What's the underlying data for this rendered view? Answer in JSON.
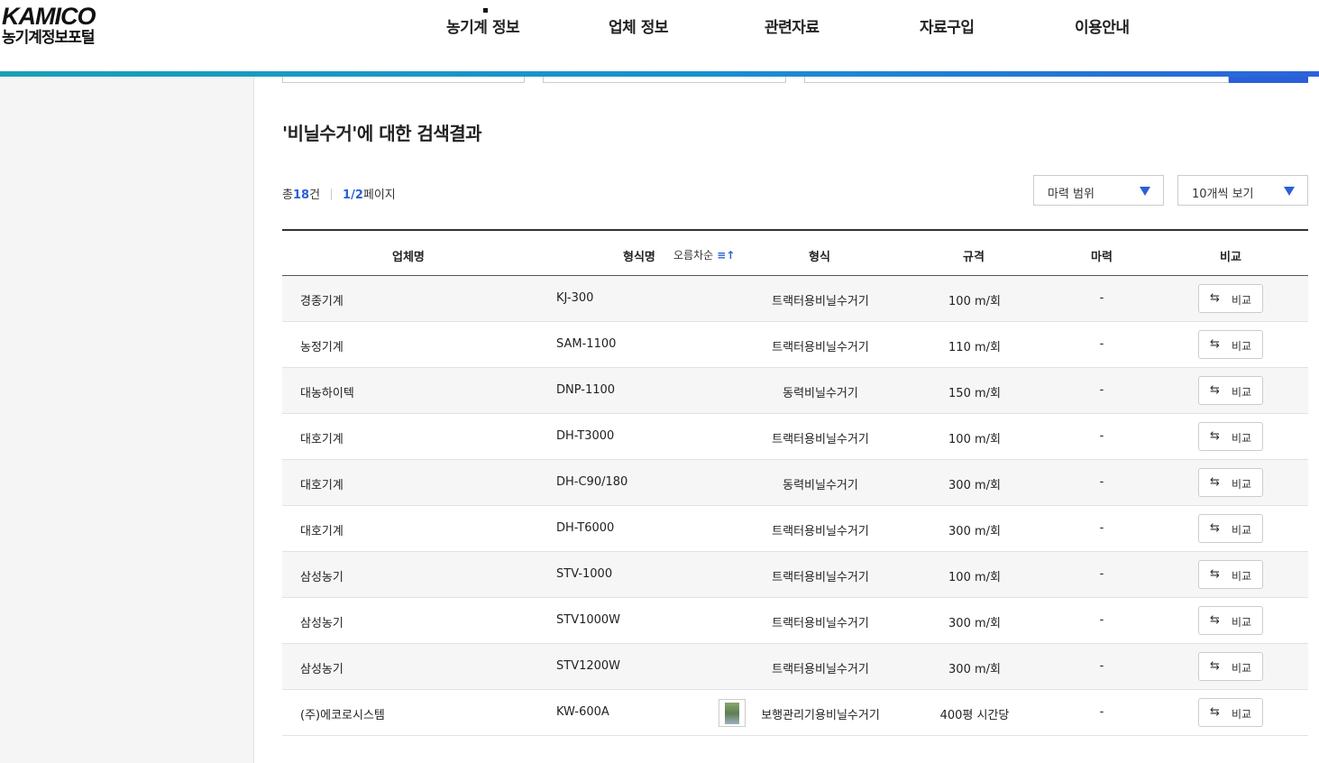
{
  "logo": {
    "brand": "KAMICO",
    "subtitle": "농기계정보포털"
  },
  "nav": [
    "농기계 정보",
    "업체 정보",
    "관련자료",
    "자료구입",
    "이용안내"
  ],
  "search_result": {
    "keyword": "'비닐수거'",
    "suffix": "에 대한 검색결과"
  },
  "count": {
    "prefix": "총",
    "total": "18",
    "unit": "건",
    "page": "1/2",
    "page_label": "페이지"
  },
  "filters": {
    "horsepower": "마력 범위",
    "per_page": "10개씩 보기"
  },
  "table": {
    "headers": {
      "company": "업체명",
      "model": "형식명",
      "sort": "오름차순",
      "type": "형식",
      "spec": "규격",
      "power": "마력",
      "compare": "비교"
    },
    "compare_label": "비교",
    "rows": [
      {
        "company": "경종기계",
        "model": "KJ-300",
        "type": "트랙터용비닐수거기",
        "spec": "100 m/회",
        "power": "-"
      },
      {
        "company": "농정기계",
        "model": "SAM-1100",
        "type": "트랙터용비닐수거기",
        "spec": "110 m/회",
        "power": "-"
      },
      {
        "company": "대농하이텍",
        "model": "DNP-1100",
        "type": "동력비닐수거기",
        "spec": "150 m/회",
        "power": "-"
      },
      {
        "company": "대호기계",
        "model": "DH-T3000",
        "type": "트랙터용비닐수거기",
        "spec": "100 m/회",
        "power": "-"
      },
      {
        "company": "대호기계",
        "model": "DH-C90/180",
        "type": "동력비닐수거기",
        "spec": "300 m/회",
        "power": "-"
      },
      {
        "company": "대호기계",
        "model": "DH-T6000",
        "type": "트랙터용비닐수거기",
        "spec": "300 m/회",
        "power": "-"
      },
      {
        "company": "삼성농기",
        "model": "STV-1000",
        "type": "트랙터용비닐수거기",
        "spec": "100 m/회",
        "power": "-"
      },
      {
        "company": "삼성농기",
        "model": "STV1000W",
        "type": "트랙터용비닐수거기",
        "spec": "300 m/회",
        "power": "-"
      },
      {
        "company": "삼성농기",
        "model": "STV1200W",
        "type": "트랙터용비닐수거기",
        "spec": "300 m/회",
        "power": "-"
      },
      {
        "company": "(주)에코로시스템",
        "model": "KW-600A",
        "type": "보행관리기용비닐수거기",
        "spec": "400평 시간당",
        "power": "-"
      }
    ]
  }
}
